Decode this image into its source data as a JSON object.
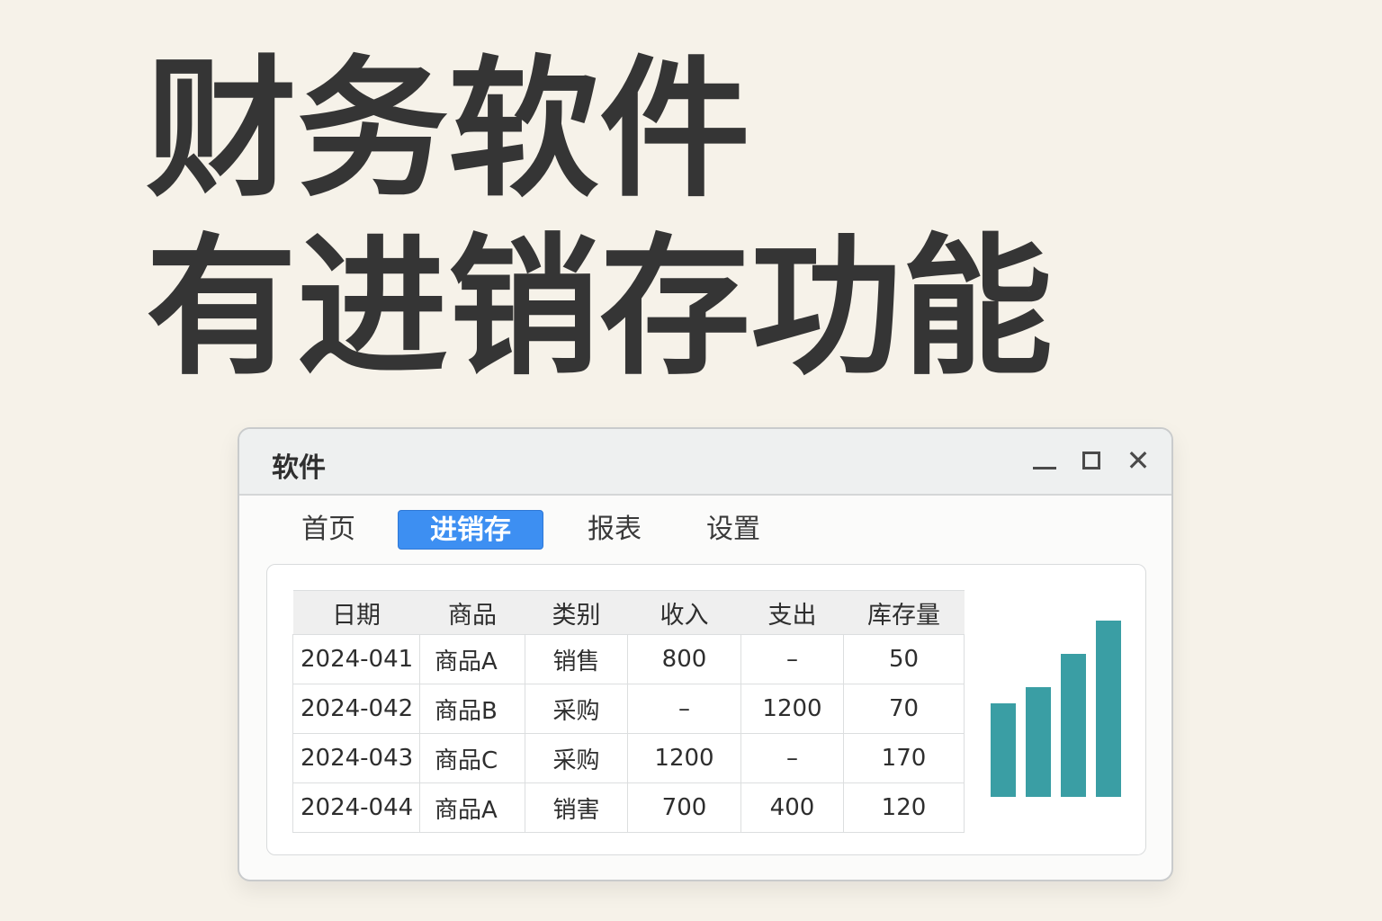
{
  "headline": {
    "line1": "财务软件",
    "line2": "有进销存功能"
  },
  "window": {
    "title": "软件",
    "controls": {
      "minimize": "minimize-icon",
      "maximize": "maximize-icon",
      "close": "close-icon"
    }
  },
  "tabs": [
    {
      "label": "首页",
      "active": false
    },
    {
      "label": "进销存",
      "active": true
    },
    {
      "label": "报表",
      "active": false
    },
    {
      "label": "设置",
      "active": false
    }
  ],
  "table": {
    "headers": [
      "日期",
      "商品",
      "类别",
      "收入",
      "支出",
      "库存量"
    ],
    "rows": [
      [
        "2024-041",
        "商品A",
        "销售",
        "800",
        "–",
        "50"
      ],
      [
        "2024-042",
        "商品B",
        "采购",
        "–",
        "1200",
        "70"
      ],
      [
        "2024-043",
        "商品C",
        "采购",
        "1200",
        "–",
        "170"
      ],
      [
        "2024-044",
        "商品A",
        "销害",
        "700",
        "400",
        "120"
      ]
    ]
  },
  "mini_chart": {
    "type": "bar",
    "relative_values": [
      0.53,
      0.62,
      0.81,
      1.0
    ],
    "color": "#3a9ea4"
  },
  "colors": {
    "background": "#f6f2e9",
    "accent": "#3d8ff2",
    "headline": "#353535"
  }
}
